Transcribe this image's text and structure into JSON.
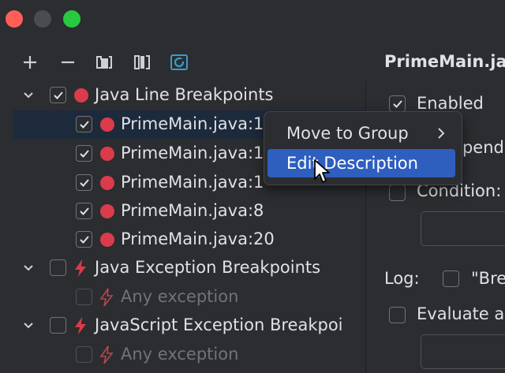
{
  "window": {
    "controls": [
      "close",
      "minimize",
      "maximize"
    ]
  },
  "toolbar": {
    "buttons": [
      "add-icon",
      "remove-icon",
      "group-by-package-icon",
      "group-by-class-icon",
      "restore-icon"
    ]
  },
  "tree": {
    "groups": [
      {
        "label": "Java Line Breakpoints",
        "checked": true,
        "expanded": true,
        "icon": "breakpoint-dot-icon",
        "items": [
          {
            "label": "PrimeMain.java:1",
            "checked": true,
            "selected": true
          },
          {
            "label": "PrimeMain.java:1",
            "checked": true
          },
          {
            "label": "PrimeMain.java:1",
            "checked": true
          },
          {
            "label": "PrimeMain.java:8",
            "checked": true
          },
          {
            "label": "PrimeMain.java:20",
            "checked": true
          }
        ]
      },
      {
        "label": "Java Exception Breakpoints",
        "checked": false,
        "expanded": true,
        "icon": "exception-bolt-icon",
        "items": [
          {
            "label": "Any exception",
            "checked": false,
            "disabled": true
          }
        ]
      },
      {
        "label": "JavaScript Exception Breakpoi",
        "checked": false,
        "expanded": true,
        "icon": "exception-bolt-icon",
        "items": [
          {
            "label": "Any exception",
            "checked": false,
            "disabled": true
          }
        ]
      }
    ]
  },
  "details": {
    "title": "PrimeMain.ja",
    "enabled_label": "Enabled",
    "suspend_label": "spend:",
    "condition_label": "Condition:",
    "log_label": "Log:",
    "log_option_label": "\"Bre",
    "evaluate_label": "Evaluate a"
  },
  "context_menu": {
    "items": [
      {
        "label": "Move to Group",
        "has_submenu": true
      },
      {
        "label": "Edit Description",
        "highlighted": true
      }
    ]
  },
  "colors": {
    "background": "#2b2d30",
    "selection": "#1d2a3c",
    "menu_highlight": "#2e5fbf",
    "breakpoint_red": "#db3b4b",
    "traffic_red": "#ff5f57",
    "traffic_green": "#28c840"
  }
}
